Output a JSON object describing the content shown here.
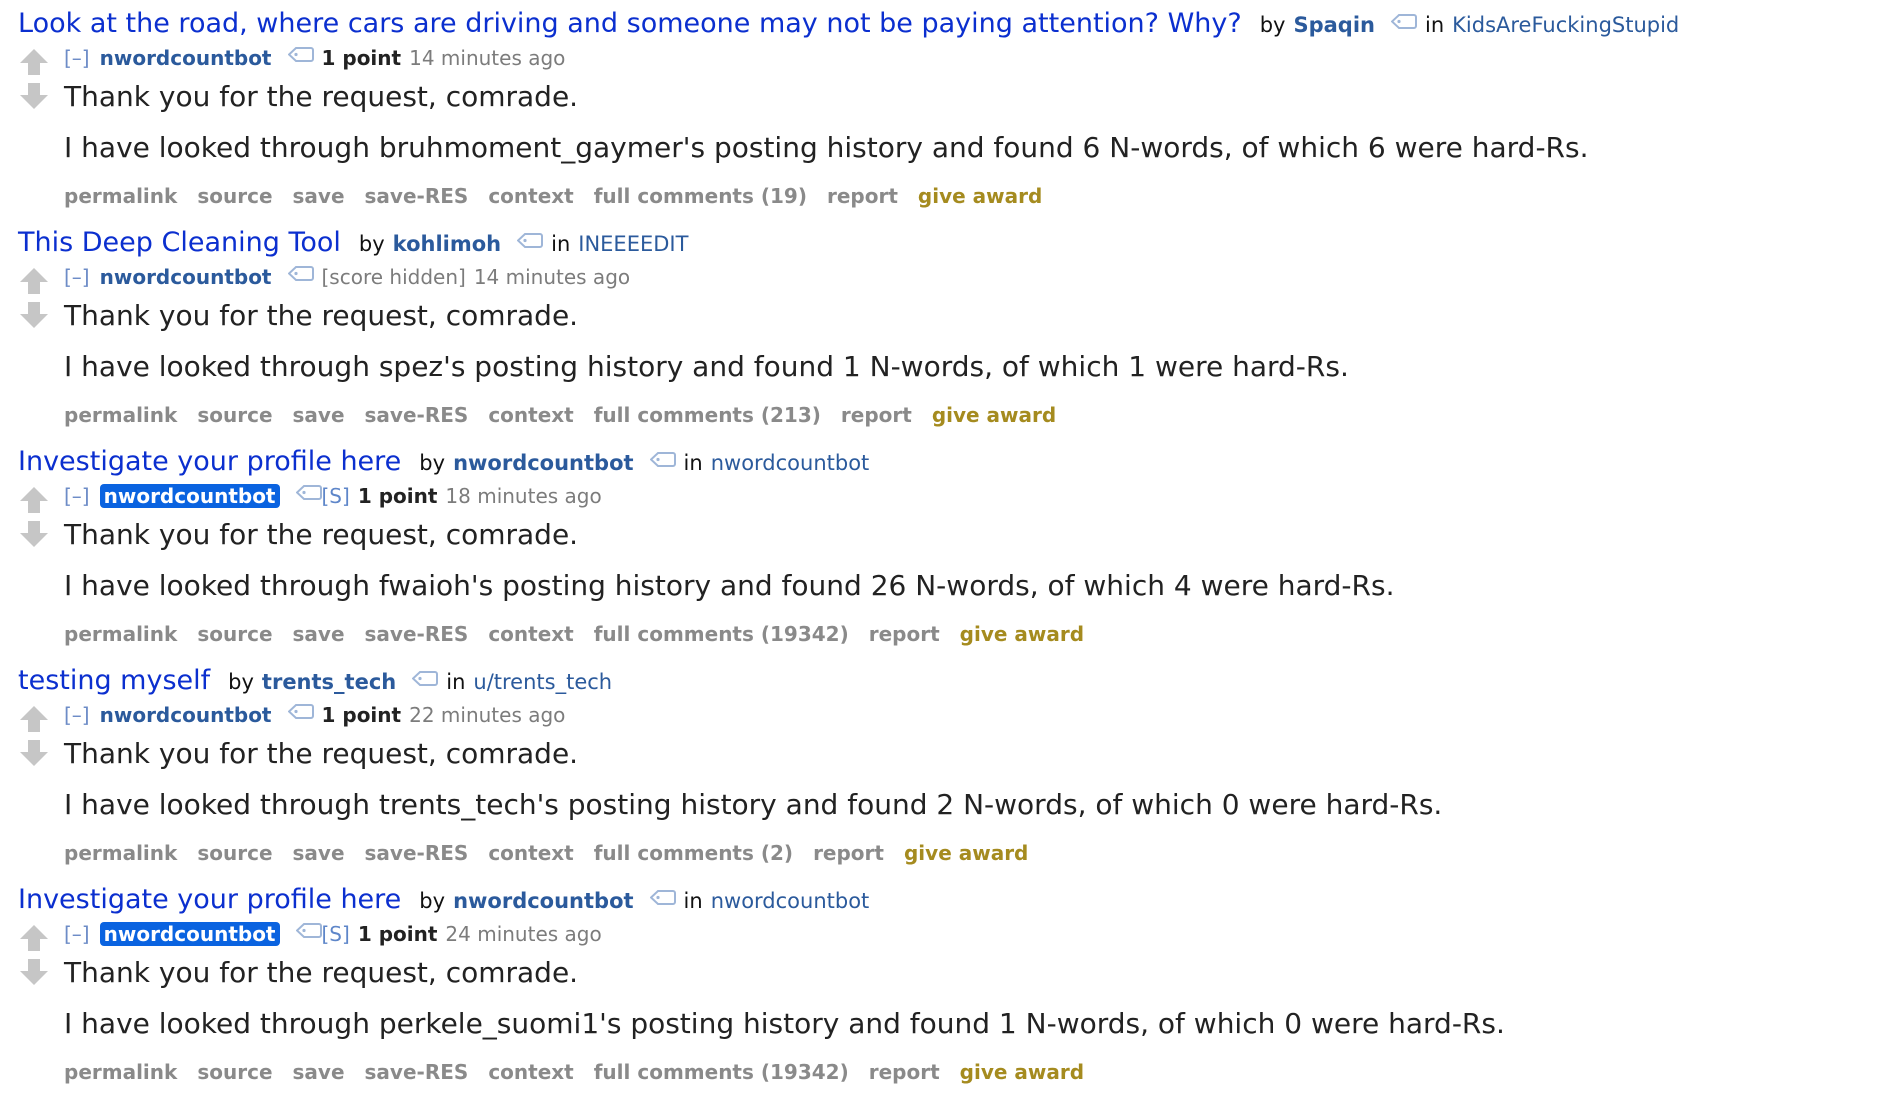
{
  "common": {
    "collapse": "[–]",
    "by": "by",
    "in": "in",
    "buttons": {
      "permalink": "permalink",
      "source": "source",
      "save": "save",
      "save_res": "save-RES",
      "context": "context",
      "report": "report",
      "give_award": "give award"
    }
  },
  "entries": [
    {
      "title": "Look at the road, where cars are driving and someone may not be paying attention? Why?",
      "post_author": "Spaqin",
      "subreddit": "KidsAreFuckingStupid",
      "comment_author": "nwordcountbot",
      "submitter_mark": "",
      "score": "1 point",
      "time": "14 minutes ago",
      "greeting": "Thank you for the request, comrade.",
      "result": "I have looked through bruhmoment_gaymer's posting history and found 6 N-words, of which 6 were hard-Rs.",
      "full_comments": "full comments (19)"
    },
    {
      "title": "This Deep Cleaning Tool",
      "post_author": "kohlimoh",
      "subreddit": "INEEEEDIT",
      "comment_author": "nwordcountbot",
      "submitter_mark": "",
      "score": "[score hidden]",
      "time": "14 minutes ago",
      "greeting": "Thank you for the request, comrade.",
      "result": "I have looked through spez's posting history and found 1 N-words, of which 1 were hard-Rs.",
      "full_comments": "full comments (213)"
    },
    {
      "title": "Investigate your profile here",
      "post_author": "nwordcountbot",
      "subreddit": "nwordcountbot",
      "comment_author": "nwordcountbot",
      "submitter_mark": "[S]",
      "score": "1 point",
      "time": "18 minutes ago",
      "greeting": "Thank you for the request, comrade.",
      "result": "I have looked through fwaioh's posting history and found 26 N-words, of which 4 were hard-Rs.",
      "full_comments": "full comments (19342)"
    },
    {
      "title": "testing myself",
      "post_author": "trents_tech",
      "subreddit": "u/trents_tech",
      "comment_author": "nwordcountbot",
      "submitter_mark": "",
      "score": "1 point",
      "time": "22 minutes ago",
      "greeting": "Thank you for the request, comrade.",
      "result": "I have looked through trents_tech's posting history and found 2 N-words, of which 0 were hard-Rs.",
      "full_comments": "full comments (2)"
    },
    {
      "title": "Investigate your profile here",
      "post_author": "nwordcountbot",
      "subreddit": "nwordcountbot",
      "comment_author": "nwordcountbot",
      "submitter_mark": "[S]",
      "score": "1 point",
      "time": "24 minutes ago",
      "greeting": "Thank you for the request, comrade.",
      "result": "I have looked through perkele_suomi1's posting history and found 1 N-words, of which 0 were hard-Rs.",
      "full_comments": "full comments (19342)"
    }
  ],
  "colors": {
    "title_link": "#0b2fcf",
    "author": "#2b5a9c",
    "submitter_bg": "#0a63e0",
    "award": "#a58b1f",
    "button_gray": "#8a8a8a",
    "arrow_gray": "#c6c6c6"
  },
  "icons": {
    "upvote": "arrow-up-icon",
    "downvote": "arrow-down-icon",
    "tag": "tag-icon"
  }
}
